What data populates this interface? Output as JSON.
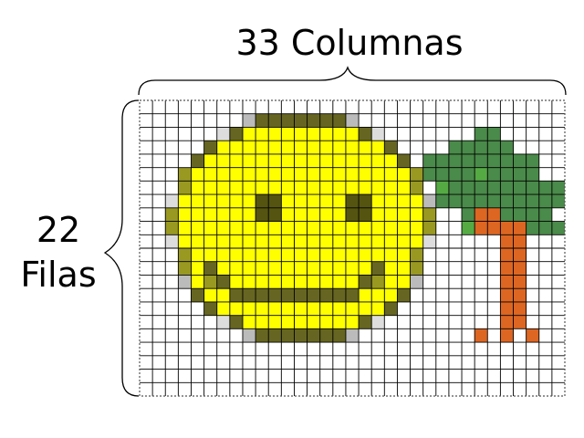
{
  "labels": {
    "columns": "33 Columnas",
    "rows_count": "22",
    "rows_word": "Filas"
  },
  "grid": {
    "cols": 33,
    "rows": 22,
    "palette": {
      "Y": "#ffff00",
      "y": "#cccc00",
      "o": "#999922",
      "D": "#666622",
      "M": "#555511",
      "g": "#dddddd",
      "G": "#bbbbbb",
      "T": "#4a8a4a",
      "t": "#55aa44",
      "R": "#dd6622"
    },
    "cells": [
      ".................................",
      "........GDDDDDDDG................",
      "......gDYYYYYYYYYDg.......TT.....",
      ".....DYYYYYYYYYYYYYD....TTTTT....",
      "....DYYYYYYYYYYYYYYYD.TTTTTTTTT..",
      "...oYYYYYYYYYYYYYYYYYoTTTTtTTTT..",
      "...oYYYYYYYYYYYYYYYYYo.tTTTTTTTTT",
      "..gYYYYYYMMYYYYYMMYYYYGTTTTTTTTTT",
      "..oYYYYYYMMYYYYYMMYYYYo..TRRTTTT.",
      "..oYYYYYYYYYYYYYYYYYYYo..tRRRRTTT",
      "..gYYYYYYYYYYYYYYYYYYYg.....RR...",
      "...oYYYYYYYYYYYYYYYYYo......RR...",
      "...oYDYYYYYYYYYYYYDYYo......RR...",
      "...GYoDYYYYYYYYYYDoYYG......RR...",
      "....DYYDDDDDDDDDDYYYD.......RR...",
      ".....DYYYYYYYYYYYYYD........RR...",
      "......gDYYYYYYYYYDg.........RR...",
      "........GDDDDDDDG.........R.R.R..",
      ".................................",
      ".................................",
      ".................................",
      "................................."
    ]
  }
}
